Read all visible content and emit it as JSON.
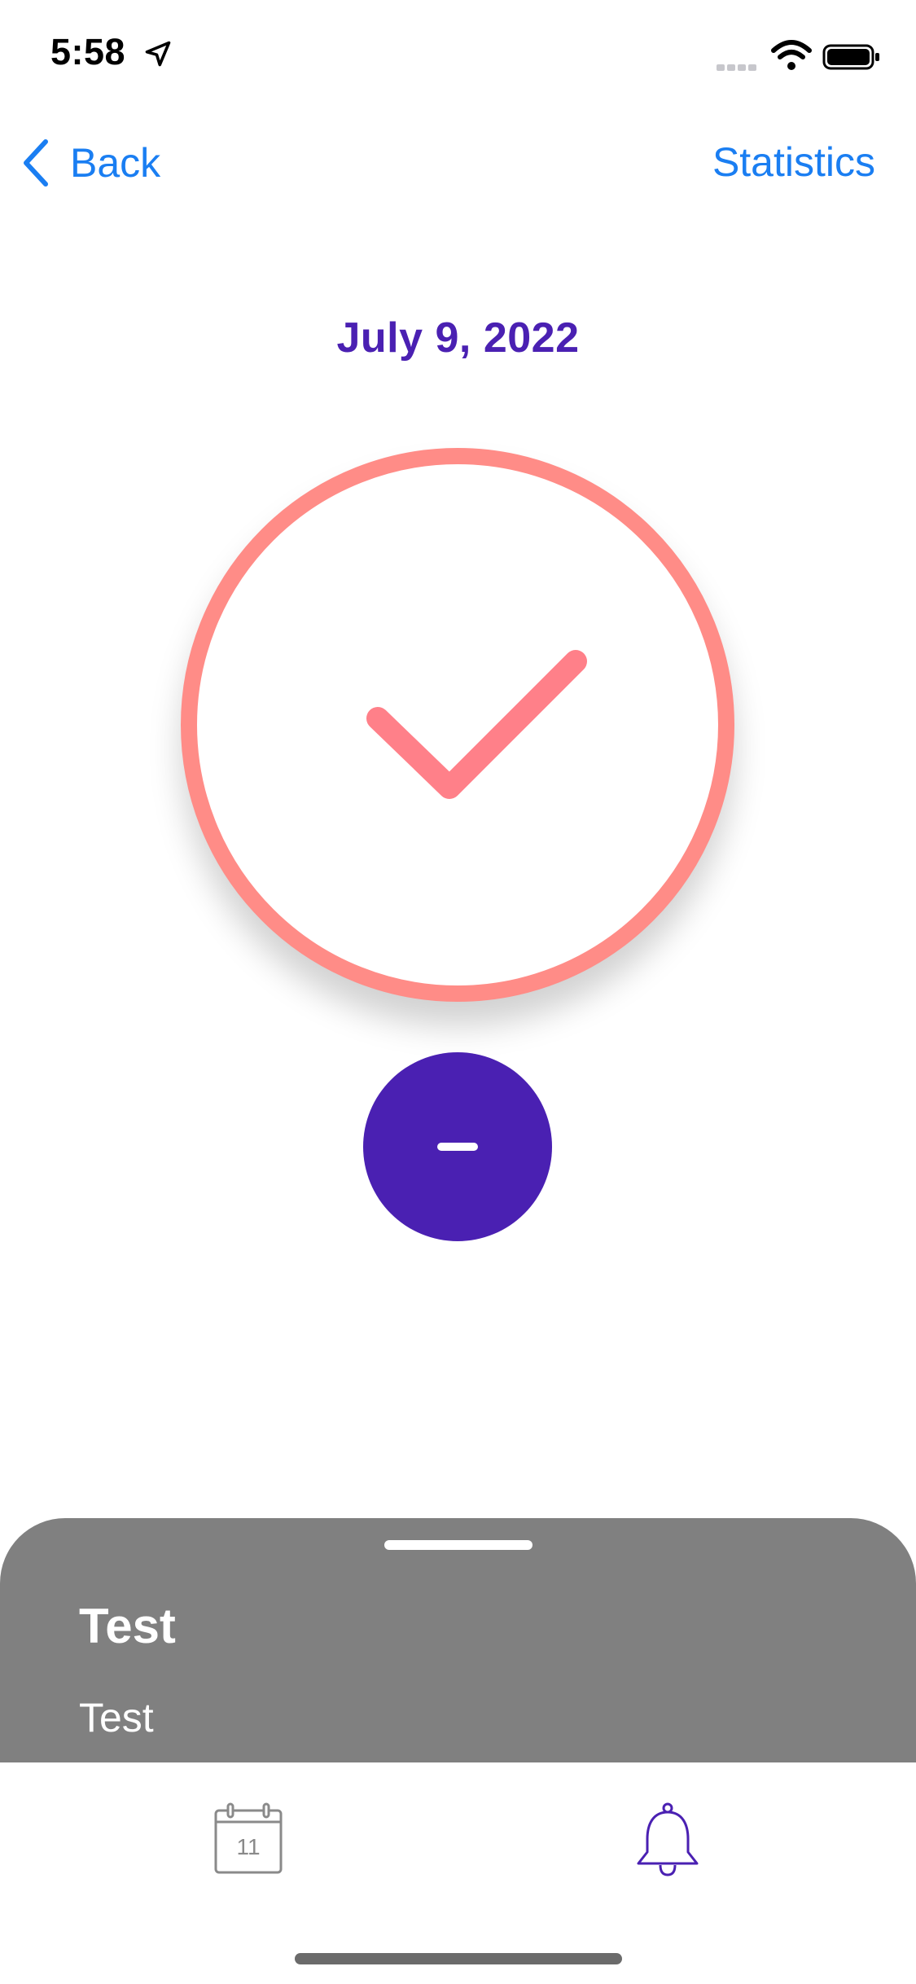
{
  "status_bar": {
    "time": "5:58"
  },
  "nav": {
    "back_label": "Back",
    "statistics_label": "Statistics"
  },
  "main": {
    "date": "July 9, 2022"
  },
  "sheet": {
    "title": "Test",
    "subtitle": "Test"
  },
  "tab_bar": {
    "calendar_day": "11"
  },
  "colors": {
    "accent_blue": "#1a7ef2",
    "brand_purple": "#4a20b2",
    "check_coral": "#ff8c87",
    "sheet_gray": "#808080"
  },
  "icons": {
    "back": "chevron-left-icon",
    "check": "checkmark-icon",
    "minus": "minus-icon",
    "calendar": "calendar-icon",
    "bell": "bell-icon",
    "location": "location-arrow-icon",
    "wifi": "wifi-icon",
    "battery": "battery-icon"
  }
}
